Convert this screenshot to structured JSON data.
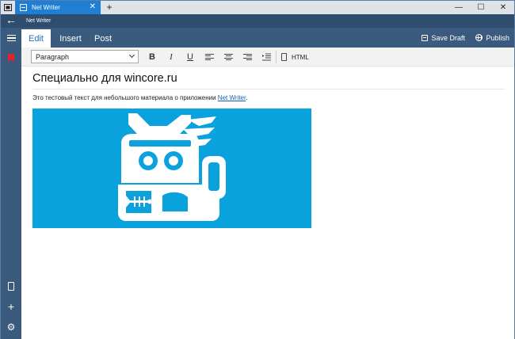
{
  "tab": {
    "title": "Net Writer",
    "close": "✕",
    "new": "+"
  },
  "window_controls": {
    "minimize": "—",
    "maximize": "☐",
    "close": "✕"
  },
  "appbar": {
    "title": "Net Writer"
  },
  "nav": {
    "back": "←"
  },
  "ribbon": {
    "tabs": [
      {
        "label": "Edit",
        "active": true
      },
      {
        "label": "Insert",
        "active": false
      },
      {
        "label": "Post",
        "active": false
      }
    ],
    "save_draft": "Save Draft",
    "publish": "Publish"
  },
  "toolbar": {
    "paragraph_style": "Paragraph",
    "bold": "B",
    "italic": "I",
    "underline": "U",
    "html_label": "HTML"
  },
  "rail": {
    "plus": "+",
    "gear": "⚙"
  },
  "editor": {
    "title": "Специально для wincore.ru",
    "text_before_link": "Это тестовый текст для небольшого материала о приложении ",
    "link_text": "Net Writer",
    "text_after_link": "."
  },
  "colors": {
    "accent": "#1f7fd4",
    "appbar": "#2f4d6e",
    "rail": "#3a5a7e",
    "image_bg": "#0aa2dc",
    "bookmark": "#e0242f"
  }
}
